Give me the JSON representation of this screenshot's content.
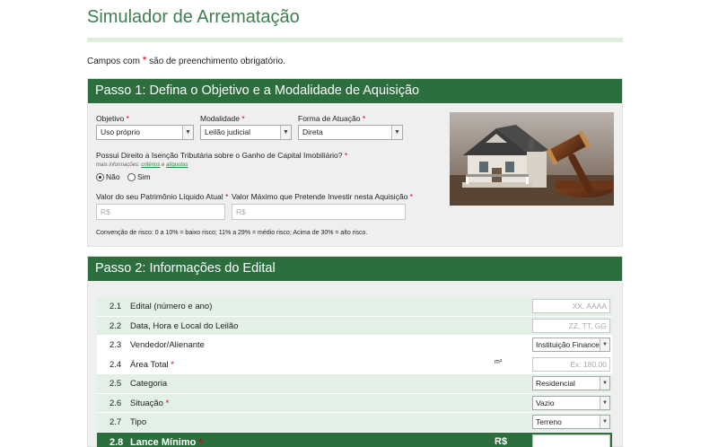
{
  "page": {
    "title": "Simulador de Arrematação",
    "required_note_before": "Campos com",
    "required_star": "*",
    "required_note_after": "são de preenchimento obrigatório."
  },
  "step1": {
    "heading": "Passo 1: Defina o Objetivo e a Modalidade de Aquisição",
    "objetivo": {
      "label": "Objetivo",
      "value": "Uso próprio"
    },
    "modalidade": {
      "label": "Modalidade",
      "value": "Leilão judicial"
    },
    "forma": {
      "label": "Forma de Atuação",
      "value": "Direta"
    },
    "isencao": {
      "question": "Possui Direito a Isenção Tributária sobre o Ganho de Capital Imobiliário?",
      "more_prefix": "mais informações:",
      "link1": "critérios",
      "link_and": "e",
      "link2": "alíquotas",
      "option_no": "Não",
      "option_yes": "Sim",
      "selected": "Não"
    },
    "patrimonio": {
      "label": "Valor do seu Patrimônio Líquido Atual",
      "placeholder": "R$"
    },
    "investir": {
      "label": "Valor Máximo que Pretende Investir nesta Aquisição",
      "placeholder": "R$"
    },
    "risk_note": "Convenção de risco: 0 a 10% = baixo risco; 11% a 29% = médio risco; Acima de 30% = alto risco."
  },
  "step2": {
    "heading": "Passo 2: Informações do Edital",
    "rows": [
      {
        "num": "2.1",
        "name": "Edital (número e ano)",
        "required": false,
        "unit": "",
        "kind": "input",
        "value": "XX, AAAA"
      },
      {
        "num": "2.2",
        "name": "Data, Hora e Local do Leilão",
        "required": false,
        "unit": "",
        "kind": "input",
        "value": "ZZ, TT, GG"
      },
      {
        "num": "2.3",
        "name": "Vendedor/Alienante",
        "required": false,
        "unit": "",
        "kind": "select",
        "value": "Instituição Financeira"
      },
      {
        "num": "2.4",
        "name": "Área Total",
        "required": true,
        "unit": "m²",
        "kind": "input",
        "value": "Ex: 180,00"
      },
      {
        "num": "2.5",
        "name": "Categoria",
        "required": false,
        "unit": "",
        "kind": "select",
        "value": "Residencial"
      },
      {
        "num": "2.6",
        "name": "Situação",
        "required": true,
        "unit": "",
        "kind": "select",
        "value": "Vazio"
      },
      {
        "num": "2.7",
        "name": "Tipo",
        "required": false,
        "unit": "",
        "kind": "select",
        "value": "Terreno"
      },
      {
        "num": "2.8",
        "name": "Lance Mínimo",
        "required": true,
        "unit": "R$",
        "kind": "input",
        "value": ""
      }
    ]
  },
  "colors": {
    "green": "#2d6e3e",
    "light_green": "#e3f0e6",
    "required": "#d0021b"
  }
}
